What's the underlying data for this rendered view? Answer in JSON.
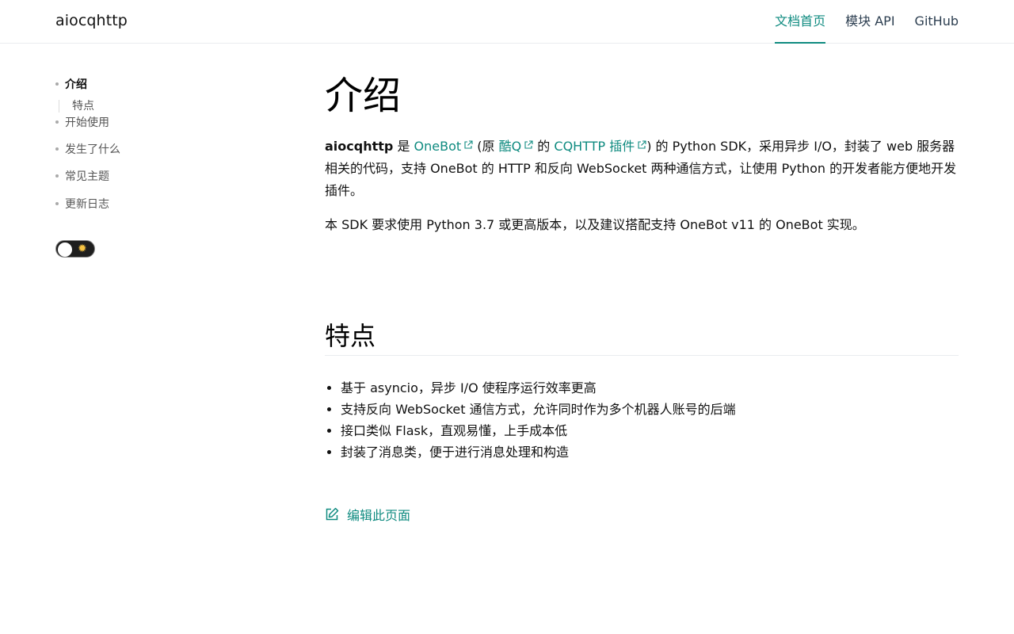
{
  "header": {
    "brand": "aiocqhttp",
    "nav": [
      {
        "label": "文档首页",
        "active": true
      },
      {
        "label": "模块 API",
        "active": false
      },
      {
        "label": "GitHub",
        "active": false
      }
    ]
  },
  "sidebar": {
    "items": [
      {
        "label": "介绍",
        "active": true
      },
      {
        "label": "开始使用"
      },
      {
        "label": "发生了什么"
      },
      {
        "label": "常见主题"
      },
      {
        "label": "更新日志"
      }
    ],
    "sub_items": [
      {
        "label": "特点"
      }
    ],
    "theme_toggle_icon": "sun-icon"
  },
  "main": {
    "title": "介绍",
    "intro": {
      "name": "aiocqhttp",
      "t1": " 是 ",
      "link_onebot": "OneBot",
      "t2": " (原 ",
      "link_kuq": "酷Q",
      "t3": " 的 ",
      "link_cqhttp": "CQHTTP 插件",
      "t4": ") 的 Python SDK，采用异步 I/O，封装了 web 服务器相关的代码，支持 OneBot 的 HTTP 和反向 WebSocket 两种通信方式，让使用 Python 的开发者能方便地开发插件。"
    },
    "requirement": "本 SDK 要求使用 Python 3.7 或更高版本，以及建议搭配支持 OneBot v11 的 OneBot 实现。",
    "features_heading": "特点",
    "features": [
      "基于 asyncio，异步 I/O 使程序运行效率更高",
      "支持反向 WebSocket 通信方式，允许同时作为多个机器人账号的后端",
      "接口类似 Flask，直观易懂，上手成本低",
      "封装了消息类，便于进行消息处理和构造"
    ],
    "edit_label": "编辑此页面"
  },
  "colors": {
    "accent": "#0f8b80",
    "text": "#111111"
  }
}
